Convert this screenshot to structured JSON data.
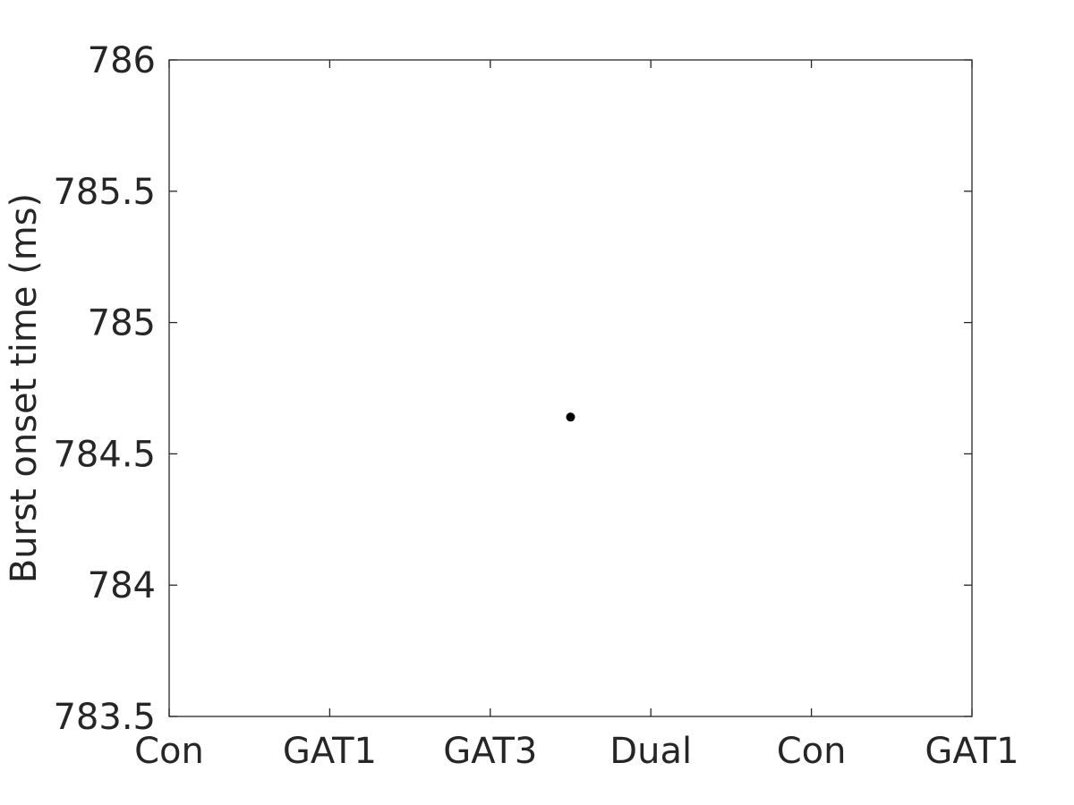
{
  "chart_data": {
    "type": "scatter",
    "title": "",
    "xlabel": "",
    "ylabel": "Burst onset time (ms)",
    "categories": [
      "Con",
      "GAT1",
      "GAT3",
      "Dual",
      "Con",
      "GAT1"
    ],
    "xlim": [
      0,
      5
    ],
    "ylim": [
      783.5,
      786
    ],
    "yticks": [
      783.5,
      784,
      784.5,
      785,
      785.5,
      786
    ],
    "ytick_labels": [
      "783.5",
      "784",
      "784.5",
      "785",
      "785.5",
      "786"
    ],
    "grid": false,
    "box": true,
    "series": [
      {
        "name": "data",
        "color": "#000000",
        "points": [
          {
            "x": 2.5,
            "y": 784.64
          }
        ]
      }
    ]
  }
}
